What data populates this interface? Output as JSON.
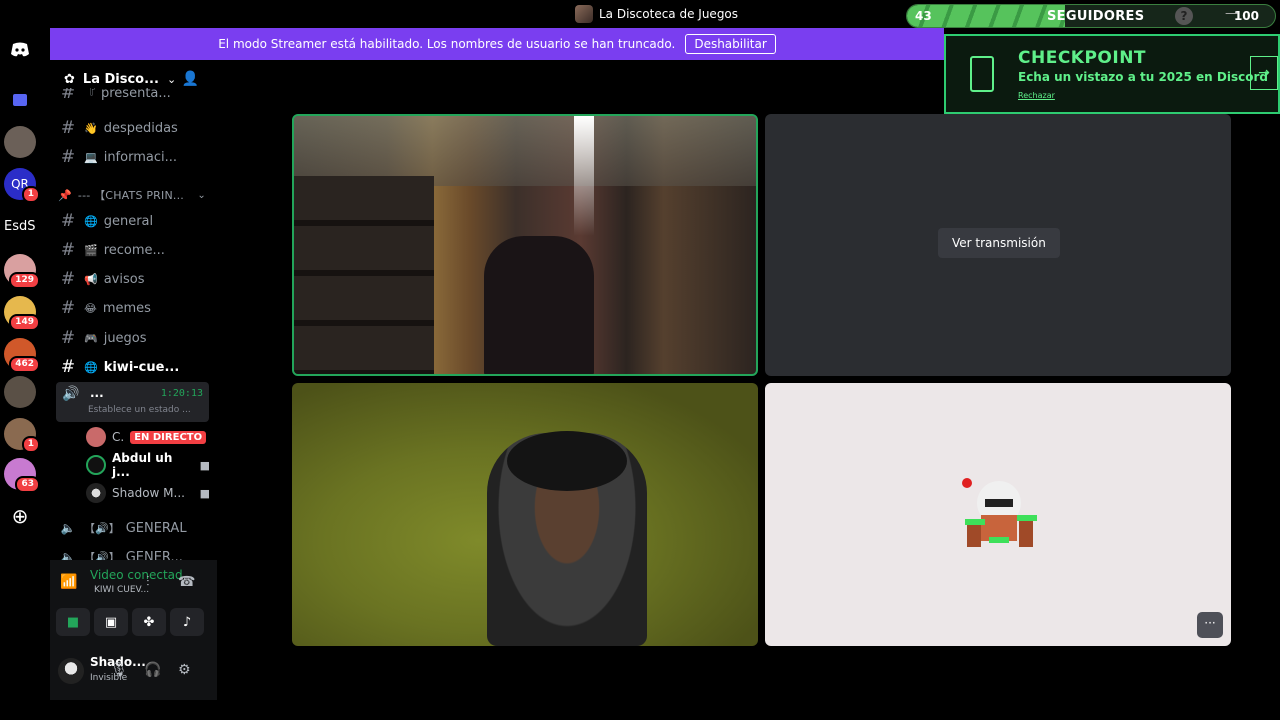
{
  "window": {
    "title": "La Discoteca de Juegos"
  },
  "followers_widget": {
    "current": "43",
    "label": "SEGUIDORES",
    "goal": "100",
    "progress_fraction": 0.43
  },
  "streamer_banner": {
    "message": "El modo Streamer está habilitado. Los nombres de usuario se han truncado.",
    "button": "Deshabilitar"
  },
  "checkpoint": {
    "title": "CHECKPOINT",
    "subtitle": "Echa un vistazo a tu 2025 en Discord",
    "dismiss": "Rechazar"
  },
  "rail": {
    "esds_label": "EsdS",
    "badges": [
      "1",
      "129",
      "149",
      "462",
      "1",
      "63"
    ]
  },
  "server": {
    "name": "La Disco..."
  },
  "channels": [
    {
      "name": "presenta...",
      "emoji": ""
    },
    {
      "name": "despedidas",
      "emoji": "👋"
    },
    {
      "name": "informaci...",
      "emoji": "💻"
    }
  ],
  "category": {
    "name": "--- 【CHATS PRIN..."
  },
  "channels2": [
    {
      "name": "general",
      "emoji": "🌐"
    },
    {
      "name": "recome...",
      "emoji": "🎬"
    },
    {
      "name": "avisos",
      "emoji": "📢"
    },
    {
      "name": "memes",
      "emoji": "😂"
    },
    {
      "name": "juegos",
      "emoji": "🎮"
    },
    {
      "name": "kiwi-cue...",
      "emoji": "🌐"
    }
  ],
  "voice_channel": {
    "name": "...",
    "timer": "1:20:13",
    "status": "Establece un estado ..."
  },
  "voice_users": [
    {
      "name": "C.",
      "badge": "EN DIRECTO"
    },
    {
      "name": "Abdul uh j..."
    },
    {
      "name": "Shadow M..."
    }
  ],
  "voice_channels_below": [
    {
      "name": "GENERAL"
    },
    {
      "name": "GENER..."
    }
  ],
  "voice_panel": {
    "title": "Video conectad",
    "subtitle": "KIWI CUEV..."
  },
  "user": {
    "name": "Shado...",
    "status": "Invisible"
  },
  "stream_tile": {
    "button": "Ver transmisión"
  },
  "colors": {
    "accent_green": "#23a55a",
    "banner_purple": "#7a3ef0",
    "checkpoint_green": "#5ff08a",
    "live_red": "#f23f43"
  }
}
